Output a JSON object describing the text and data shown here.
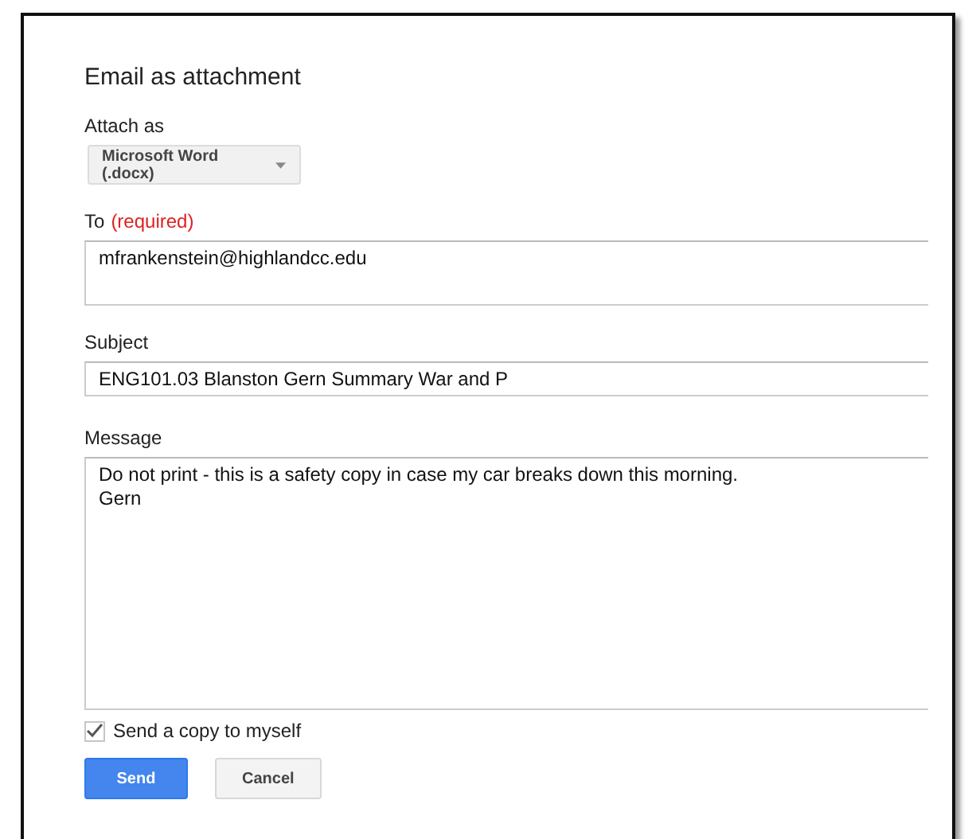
{
  "dialog": {
    "title": "Email as attachment"
  },
  "attach_as": {
    "label": "Attach as",
    "value": "Microsoft Word (.docx)"
  },
  "to": {
    "label": "To",
    "required_note": "(required)",
    "value": "mfrankenstein@highlandcc.edu"
  },
  "subject": {
    "label": "Subject",
    "value": "ENG101.03 Blanston Gern Summary War and P"
  },
  "message": {
    "label": "Message",
    "value": "Do not print - this is a safety copy in case my car breaks down this morning.\nGern"
  },
  "copy_to_self": {
    "label": "Send a copy to myself",
    "checked": true
  },
  "buttons": [
    {
      "label": "Send",
      "kind": "primary"
    },
    {
      "label": "Cancel",
      "kind": "secondary"
    }
  ]
}
